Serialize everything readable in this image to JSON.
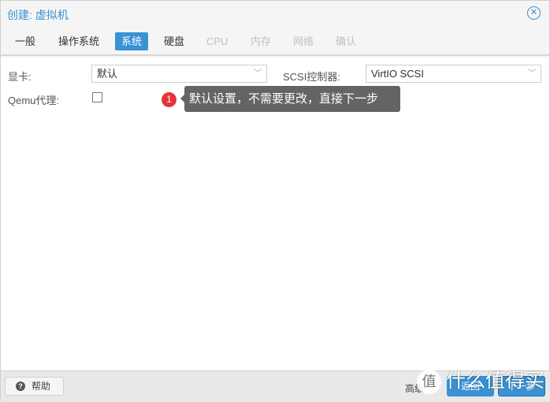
{
  "window": {
    "title": "创建: 虚拟机",
    "close_icon": "circle-x"
  },
  "tabs": [
    {
      "label": "一般",
      "state": "normal"
    },
    {
      "label": "操作系统",
      "state": "normal"
    },
    {
      "label": "系统",
      "state": "active"
    },
    {
      "label": "硬盘",
      "state": "normal"
    },
    {
      "label": "CPU",
      "state": "disabled"
    },
    {
      "label": "内存",
      "state": "disabled"
    },
    {
      "label": "网络",
      "state": "disabled"
    },
    {
      "label": "确认",
      "state": "disabled"
    }
  ],
  "form": {
    "graphics_label": "显卡:",
    "graphics_value": "默认",
    "scsi_label": "SCSI控制器:",
    "scsi_value": "VirtIO SCSI",
    "qemu_agent_label": "Qemu代理:",
    "qemu_agent_checked": false
  },
  "annotation": {
    "badge": "1",
    "text": "默认设置，不需要更改，直接下一步",
    "badge_color": "#e8333a"
  },
  "footer": {
    "help_label": "帮助",
    "advanced_label": "高级",
    "back_label": "返回",
    "next_label": "下一步"
  },
  "watermark": {
    "circle": "值",
    "text": "什么值得买"
  },
  "colors": {
    "accent": "#3892d4"
  }
}
